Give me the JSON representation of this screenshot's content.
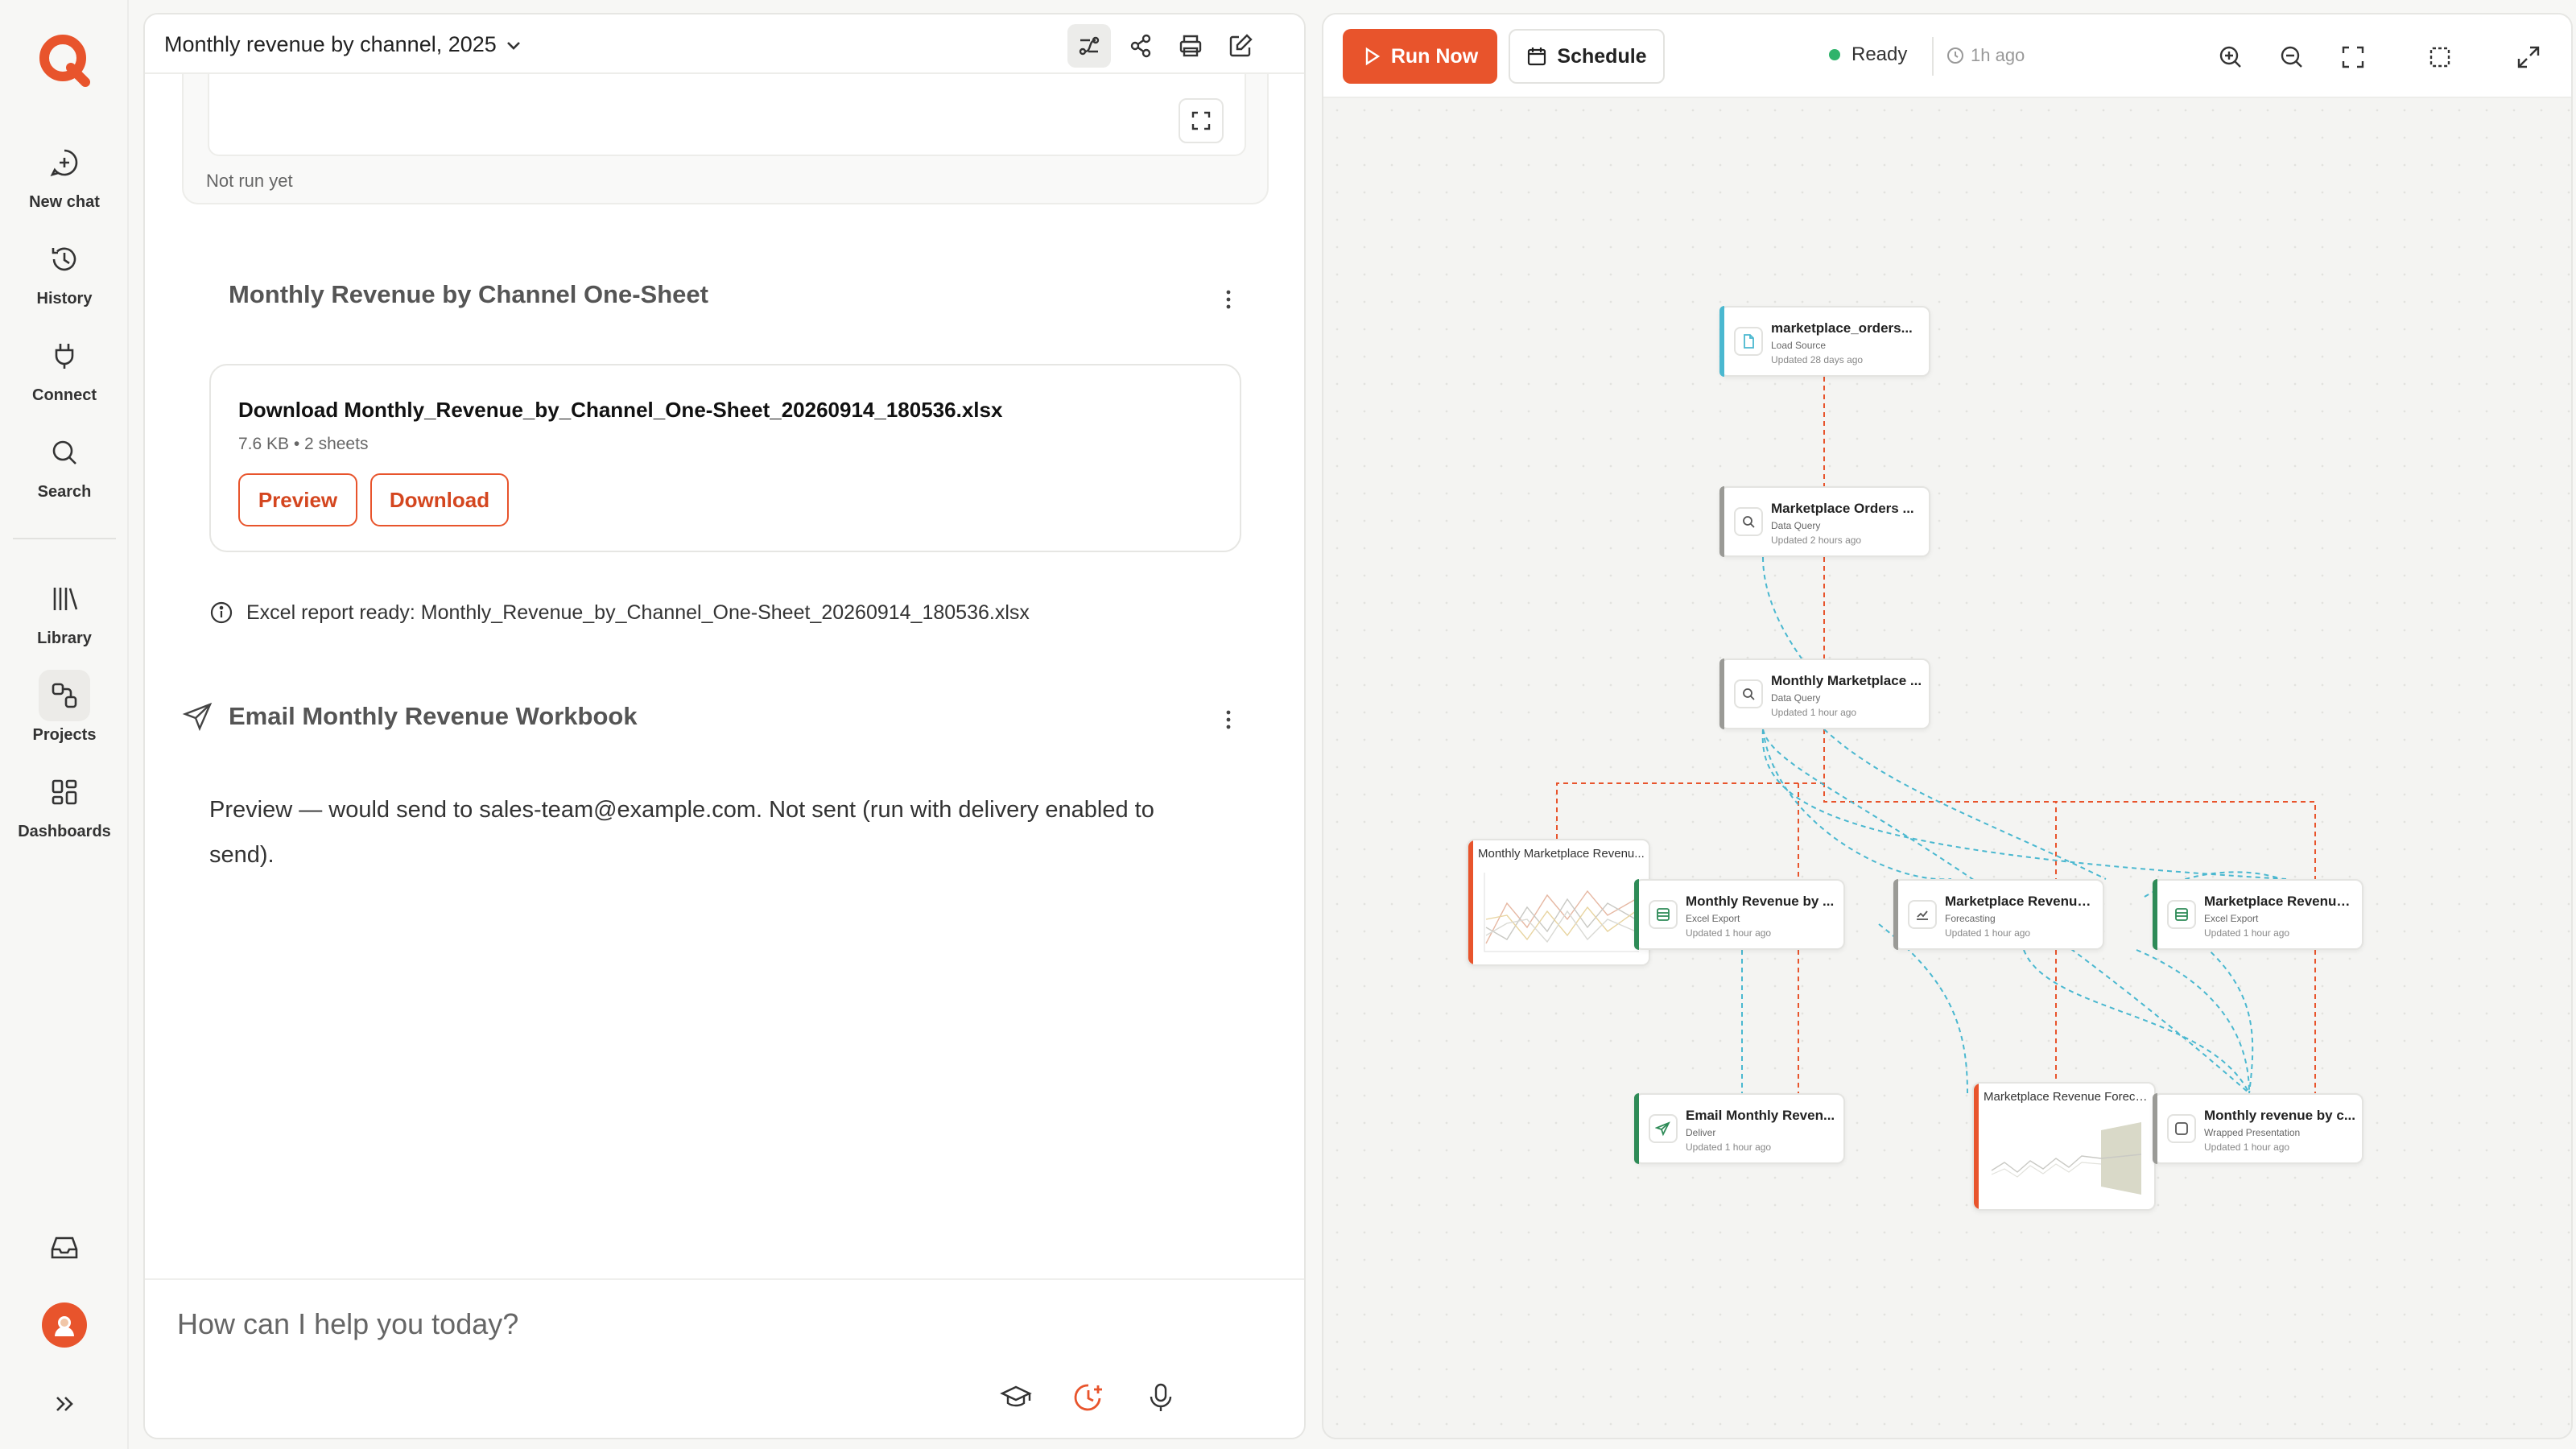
{
  "rail": {
    "items": [
      {
        "label": "New chat",
        "icon": "new-chat-icon"
      },
      {
        "label": "History",
        "icon": "history-icon"
      },
      {
        "label": "Connect",
        "icon": "plug-icon"
      },
      {
        "label": "Search",
        "icon": "search-icon"
      },
      {
        "label": "Library",
        "icon": "library-icon"
      },
      {
        "label": "Projects",
        "icon": "projects-icon"
      },
      {
        "label": "Dashboards",
        "icon": "dashboards-icon"
      }
    ],
    "active": "Projects"
  },
  "chat": {
    "title": "Monthly revenue by channel, 2025",
    "not_run": "Not run yet",
    "section_one_sheet": "Monthly Revenue by Channel One-Sheet",
    "file": {
      "name": "Download Monthly_Revenue_by_Channel_One-Sheet_20260914_180536.xlsx",
      "meta": "7.6 KB • 2 sheets",
      "preview_label": "Preview",
      "download_label": "Download"
    },
    "info_text": "Excel report ready: Monthly_Revenue_by_Channel_One-Sheet_20260914_180536.xlsx",
    "section_email": "Email Monthly Revenue Workbook",
    "email_text": "Preview — would send to sales-team@example.com. Not sent (run with delivery enabled to send).",
    "input_placeholder": "How can I help you today?"
  },
  "canvas": {
    "run_label": "Run Now",
    "schedule_label": "Schedule",
    "status": "Ready",
    "last_run": "1h ago",
    "nodes": {
      "source": {
        "title": "marketplace_orders...",
        "subtitle": "Load Source",
        "updated": "Updated 28 days ago"
      },
      "orders_query": {
        "title": "Marketplace Orders ...",
        "subtitle": "Data Query",
        "updated": "Updated 2 hours ago"
      },
      "monthly_query": {
        "title": "Monthly Marketplace ...",
        "subtitle": "Data Query",
        "updated": "Updated 1 hour ago"
      },
      "chart": {
        "title": "Monthly Marketplace Revenu..."
      },
      "excel_one": {
        "title": "Monthly Revenue by ...",
        "subtitle": "Excel Export",
        "updated": "Updated 1 hour ago"
      },
      "forecast": {
        "title": "Marketplace Revenue...",
        "subtitle": "Forecasting",
        "updated": "Updated 1 hour ago"
      },
      "excel_two": {
        "title": "Marketplace Revenue...",
        "subtitle": "Excel Export",
        "updated": "Updated 1 hour ago"
      },
      "email": {
        "title": "Email Monthly Reven...",
        "subtitle": "Deliver",
        "updated": "Updated 1 hour ago"
      },
      "forecast_chart": {
        "title": "Marketplace Revenue Foreca..."
      },
      "presentation": {
        "title": "Monthly revenue by c...",
        "subtitle": "Wrapped Presentation",
        "updated": "Updated 1 hour ago"
      }
    }
  },
  "colors": {
    "accent": "#e8542c",
    "teal": "#4ab8d0",
    "green_bar": "#2e8b57",
    "ready": "#2fb36b"
  }
}
